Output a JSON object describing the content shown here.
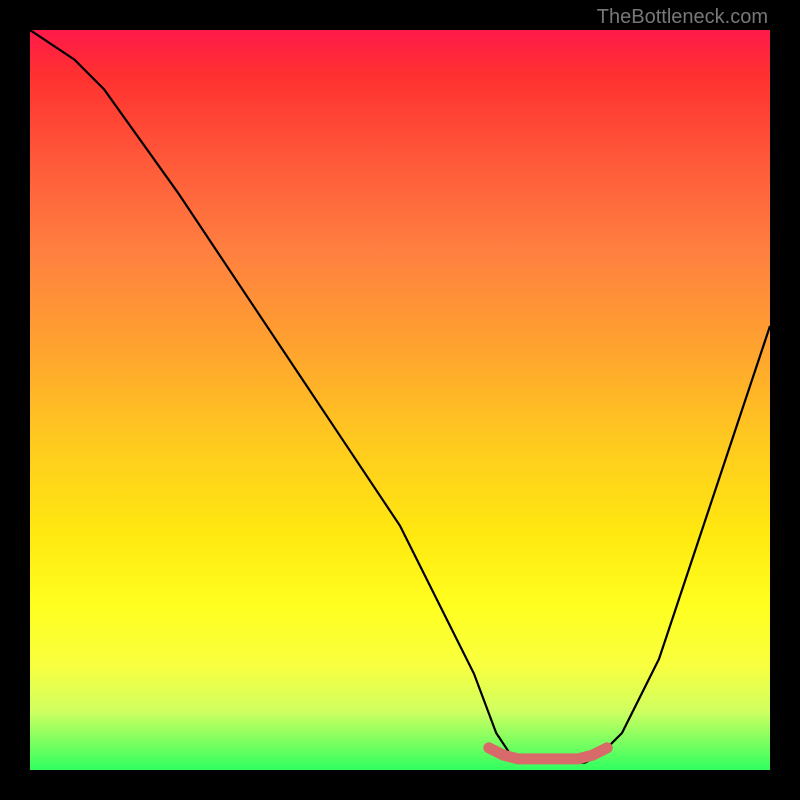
{
  "attribution": "TheBottleneck.com",
  "chart_data": {
    "type": "line",
    "title": "",
    "xlabel": "",
    "ylabel": "",
    "xlim": [
      0,
      100
    ],
    "ylim": [
      0,
      100
    ],
    "series": [
      {
        "name": "bottleneck-curve",
        "x": [
          0,
          6,
          10,
          20,
          30,
          40,
          50,
          60,
          63,
          65,
          68,
          72,
          75,
          77,
          80,
          85,
          90,
          95,
          100
        ],
        "values": [
          100,
          96,
          92,
          78,
          63,
          48,
          33,
          13,
          5,
          2,
          1,
          1,
          1,
          2,
          5,
          15,
          30,
          45,
          60
        ]
      },
      {
        "name": "sweet-spot-marker",
        "x": [
          62,
          64,
          66,
          68,
          70,
          72,
          74,
          76,
          78
        ],
        "values": [
          3,
          2,
          1.5,
          1.5,
          1.5,
          1.5,
          1.5,
          2,
          3
        ]
      }
    ],
    "colors": {
      "curve": "#000000",
      "marker": "#d86a6a",
      "gradient_top": "#ff1a4a",
      "gradient_bottom": "#30ff60"
    }
  }
}
